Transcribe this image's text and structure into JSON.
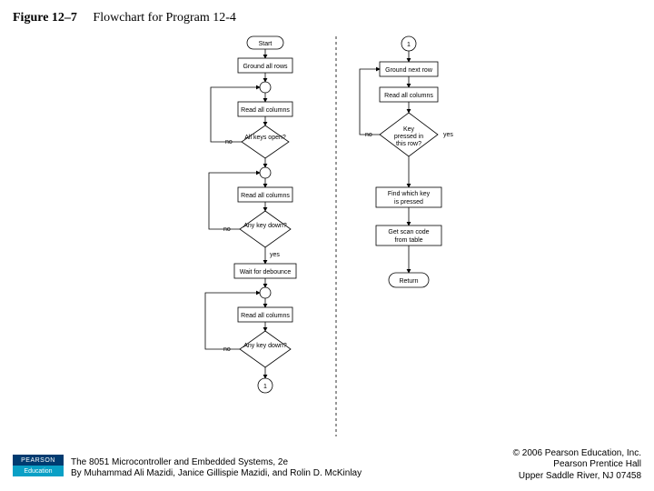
{
  "title": {
    "figure_label": "Figure 12–7",
    "caption": "Flowchart for Program 12-4"
  },
  "flow": {
    "left": {
      "start": "Start",
      "ground_rows": "Ground all rows",
      "read_cols_1": "Read all columns",
      "all_open": "All keys open?",
      "all_open_no": "no",
      "read_cols_2": "Read all columns",
      "any_down_1": "Any key down?",
      "any_down_1_no": "no",
      "any_down_1_yes": "yes",
      "wait_debounce": "Wait for debounce",
      "read_cols_3": "Read all columns",
      "any_down_2": "Any key down?",
      "any_down_2_no": "no",
      "conn_out": "1"
    },
    "right": {
      "conn_in": "1",
      "ground_next": "Ground next row",
      "read_cols": "Read all columns",
      "key_this_row": "Key pressed in this row?",
      "this_row_no": "no",
      "this_row_yes": "yes",
      "find_key": "Find which key is pressed",
      "get_scan": "Get scan code from table",
      "return": "Return"
    }
  },
  "footer": {
    "logo_top": "PEARSON",
    "logo_bottom": "Education",
    "book_line1": "The 8051 Microcontroller and Embedded Systems, 2e",
    "book_line2": "By Muhammad Ali Mazidi, Janice Gillispie Mazidi, and Rolin D. McKinlay",
    "copyright_line1": "© 2006 Pearson Education, Inc.",
    "copyright_line2": "Pearson Prentice Hall",
    "copyright_line3": "Upper Saddle River, NJ 07458"
  }
}
